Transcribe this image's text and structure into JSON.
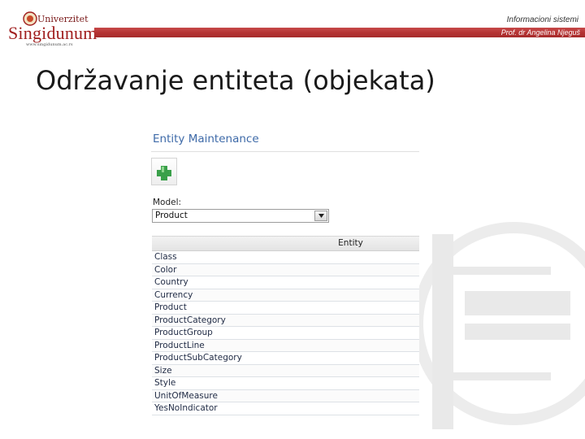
{
  "header": {
    "logo_top": "Univerzitet",
    "logo_name": "Singidunum",
    "logo_web": "www.singidunum.ac.rs",
    "course": "Informacioni sistemi",
    "author": "Prof. dr Angelina Njeguš"
  },
  "slide": {
    "title": "Održavanje entiteta (objekata)"
  },
  "screenshot": {
    "panel_title": "Entity Maintenance",
    "add_icon": "plus-icon",
    "model_label": "Model:",
    "model_value": "Product",
    "grid_header": "Entity",
    "entities": [
      "Class",
      "Color",
      "Country",
      "Currency",
      "Product",
      "ProductCategory",
      "ProductGroup",
      "ProductLine",
      "ProductSubCategory",
      "Size",
      "Style",
      "UnitOfMeasure",
      "YesNoIndicator"
    ]
  },
  "colors": {
    "brand_red": "#a62b2b",
    "link_blue": "#3e6aa8",
    "plus_green": "#3aa04a"
  }
}
